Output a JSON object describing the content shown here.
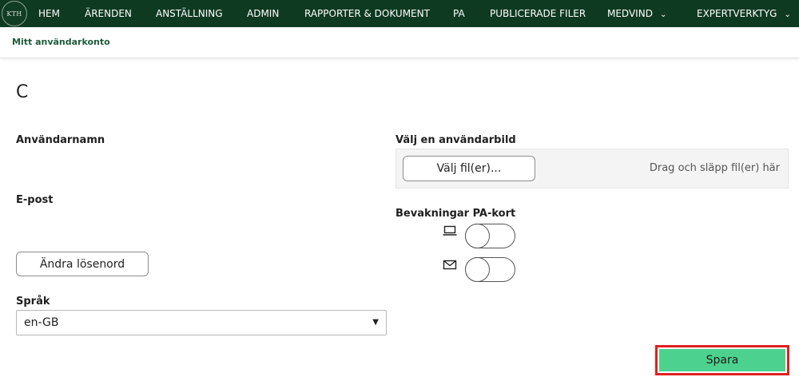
{
  "nav": {
    "logo_text": "KTH",
    "items": [
      {
        "label": "HEM",
        "has_dropdown": false
      },
      {
        "label": "ÄRENDEN",
        "has_dropdown": false
      },
      {
        "label": "ANSTÄLLNING",
        "has_dropdown": false
      },
      {
        "label": "ADMIN",
        "has_dropdown": false
      },
      {
        "label": "RAPPORTER & DOKUMENT",
        "has_dropdown": false
      },
      {
        "label": "PA",
        "has_dropdown": false
      },
      {
        "label": "PUBLICERADE FILER",
        "has_dropdown": false
      },
      {
        "label": "MEDVIND",
        "has_dropdown": true
      },
      {
        "label": "EXPERTVERKTYG",
        "has_dropdown": true
      }
    ],
    "chevron": "⌄"
  },
  "breadcrumb": "Mitt användarkonto",
  "profile": {
    "avatar_letter": "C",
    "username_label": "Användarnamn",
    "email_label": "E-post",
    "change_password_button": "Ändra lösenord",
    "language_label": "Språk",
    "language_value": "en-GB"
  },
  "picture": {
    "label": "Välj en användarbild",
    "choose_button": "Välj fil(er)...",
    "drop_hint": "Drag och släpp fil(er) här"
  },
  "subscriptions": {
    "label": "Bevakningar PA-kort",
    "toggles": [
      {
        "icon": "laptop-icon",
        "on": false
      },
      {
        "icon": "envelope-icon",
        "on": false
      }
    ]
  },
  "save_button": "Spara",
  "colors": {
    "nav_bg": "#0f3a22",
    "save_bg": "#4cd28e",
    "highlight": "#e02020"
  }
}
